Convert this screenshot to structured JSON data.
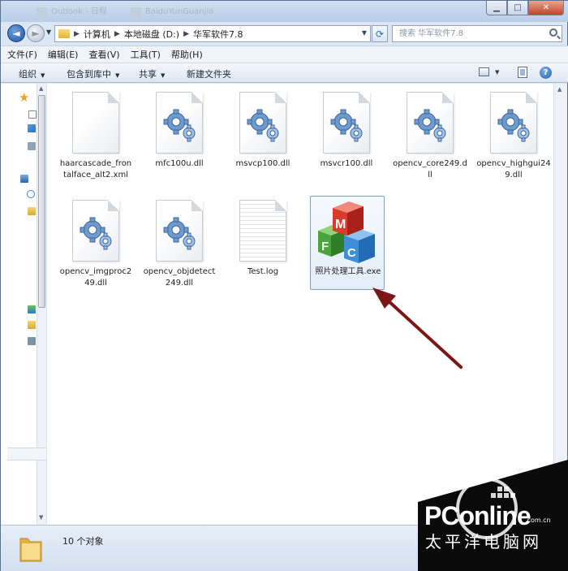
{
  "titlebar": {
    "ghost_tabs": [
      "Outlook - 日程",
      "BaiduYunGuanjia"
    ],
    "min_label": "▁",
    "max_label": "□",
    "close_label": "✕"
  },
  "nav": {
    "back_glyph": "◄",
    "forward_glyph": "►",
    "breadcrumb": [
      "计算机",
      "本地磁盘 (D:)",
      "华军软件7.8"
    ],
    "refresh_glyph": "⟳",
    "search_placeholder": "搜索 华军软件7.8"
  },
  "menu": [
    "文件(F)",
    "编辑(E)",
    "查看(V)",
    "工具(T)",
    "帮助(H)"
  ],
  "commands": {
    "organize": "组织",
    "include_library": "包含到库中",
    "share": "共享",
    "new_folder": "新建文件夹",
    "help_glyph": "?"
  },
  "files": [
    {
      "name": "haarcascade_frontalface_alt2.xml",
      "icon": "blank-document-icon"
    },
    {
      "name": "mfc100u.dll",
      "icon": "dll-gear-icon"
    },
    {
      "name": "msvcp100.dll",
      "icon": "dll-gear-icon"
    },
    {
      "name": "msvcr100.dll",
      "icon": "dll-gear-icon"
    },
    {
      "name": "opencv_core249.dll",
      "icon": "dll-gear-icon"
    },
    {
      "name": "opencv_highgui249.dll",
      "icon": "dll-gear-icon"
    },
    {
      "name": "opencv_imgproc249.dll",
      "icon": "dll-gear-icon"
    },
    {
      "name": "opencv_objdetect249.dll",
      "icon": "dll-gear-icon"
    },
    {
      "name": "Test.log",
      "icon": "log-document-icon"
    },
    {
      "name": "照片处理工具.exe",
      "icon": "mfc-app-icon"
    }
  ],
  "status": {
    "item_count": "10 个对象"
  },
  "watermark": {
    "brand": "PConline",
    "domain": ".com.cn",
    "cn": "太平洋电脑网"
  },
  "colors": {
    "accent": "#2a63b8",
    "selection_border": "#7da2ce",
    "arrow": "#7a1616"
  }
}
